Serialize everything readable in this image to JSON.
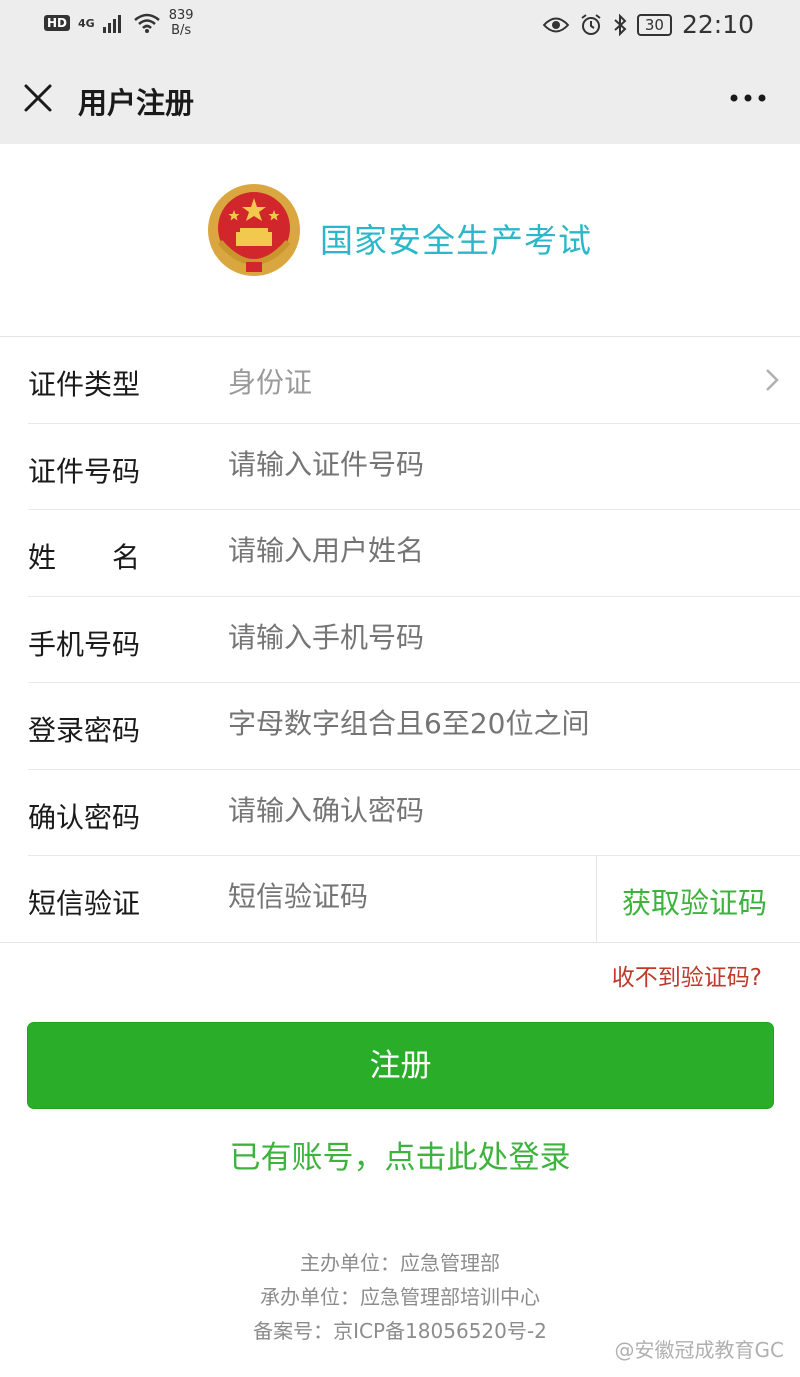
{
  "status_bar": {
    "hd": "HD",
    "network": "4G",
    "speed_value": "839",
    "speed_unit": "B/s",
    "battery": "30",
    "time": "22:10"
  },
  "nav": {
    "title": "用户注册"
  },
  "logo": {
    "text": "国家安全生产考试"
  },
  "form": {
    "id_type": {
      "label": "证件类型",
      "value": "身份证"
    },
    "id_number": {
      "label": "证件号码",
      "placeholder": "请输入证件号码"
    },
    "name": {
      "label": "姓　　名",
      "placeholder": "请输入用户姓名"
    },
    "phone": {
      "label": "手机号码",
      "placeholder": "请输入手机号码"
    },
    "password": {
      "label": "登录密码",
      "placeholder": "字母数字组合且6至20位之间"
    },
    "confirm_password": {
      "label": "确认密码",
      "placeholder": "请输入确认密码"
    },
    "sms": {
      "label": "短信验证",
      "placeholder": "短信验证码",
      "get_code": "获取验证码"
    }
  },
  "no_code_link": "收不到验证码?",
  "register_button": "注册",
  "login_link": "已有账号，点击此处登录",
  "footer": {
    "sponsor": "主办单位：应急管理部",
    "organizer": "承办单位：应急管理部培训中心",
    "icp": "备案号：京ICP备18056520号-2"
  },
  "watermark": "@安徽冠成教育GC",
  "colors": {
    "accent_green": "#2aae2a",
    "link_green": "#3db33d",
    "logo_cyan": "#2cb7c9",
    "warning_red": "#c0392b"
  }
}
